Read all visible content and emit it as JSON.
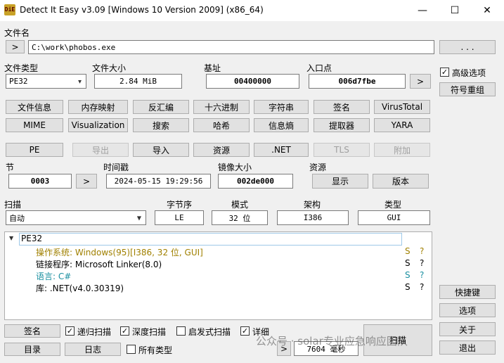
{
  "window": {
    "title": "Detect It Easy v3.09 [Windows 10 Version 2009] (x86_64)",
    "icon_label": "DiE",
    "minimize_glyph": "—",
    "maximize_glyph": "☐",
    "close_glyph": "✕"
  },
  "file": {
    "name_label": "文件名",
    "open_button": ">",
    "path": "C:\\work\\phobos.exe",
    "browse_button": ". . ."
  },
  "info": {
    "type_label": "文件类型",
    "type_value": "PE32",
    "size_label": "文件大小",
    "size_value": "2.84 MiB",
    "base_label": "基址",
    "base_value": "00400000",
    "entry_label": "入口点",
    "entry_value": "006d7fbe",
    "entry_button": ">"
  },
  "tools_row1": [
    "文件信息",
    "内存映射",
    "反汇编",
    "十六进制",
    "字符串",
    "签名",
    "VirusTotal"
  ],
  "tools_row2": [
    "MIME",
    "Visualization",
    "搜索",
    "哈希",
    "信息熵",
    "提取器",
    "YARA"
  ],
  "pe_row": {
    "pe": "PE",
    "export": "导出",
    "import": "导入",
    "resource": "资源",
    "net": ".NET",
    "tls": "TLS",
    "overlay": "附加"
  },
  "section": {
    "sections_label": "节",
    "sections_value": "0003",
    "sections_button": ">",
    "timestamp_label": "时间戳",
    "timestamp_value": "2024-05-15 19:29:56",
    "image_size_label": "镜像大小",
    "image_size_value": "002de000",
    "resources_label": "资源",
    "show_button": "显示",
    "version_button": "版本"
  },
  "scan_opts": {
    "scan_label": "扫描",
    "scan_value": "自动",
    "endian_label": "字节序",
    "endian_value": "LE",
    "mode_label": "模式",
    "mode_value": "32 位",
    "arch_label": "架构",
    "arch_value": "I386",
    "type_label": "类型",
    "type_value": "GUI"
  },
  "results": {
    "root": "PE32",
    "expand_glyph": "▼",
    "items": [
      {
        "text": "操作系统: Windows(95)[I386, 32 位, GUI]",
        "color": "#a08000",
        "s": "S",
        "q": "?"
      },
      {
        "text": "链接程序: Microsoft Linker(8.0)",
        "color": "#000000",
        "s": "S",
        "q": "?"
      },
      {
        "text": "语言: C#",
        "color": "#1a8fa0",
        "s": "S",
        "q": "?"
      },
      {
        "text": "库: .NET(v4.0.30319)",
        "color": "#000000",
        "s": "S",
        "q": "?"
      }
    ]
  },
  "right_panel": {
    "advanced_label": "高级选项",
    "advanced_checked": "✓",
    "regroup_button": "符号重组",
    "shortcut_button": "快捷键",
    "options_button": "选项",
    "about_button": "关于",
    "exit_button": "退出"
  },
  "bottom": {
    "signature_button": "签名",
    "recursive_label": "递归扫描",
    "recursive_checked": "✓",
    "deep_label": "深度扫描",
    "deep_checked": "✓",
    "heuristic_label": "启发式扫描",
    "heuristic_checked": "",
    "verbose_label": "详细",
    "verbose_checked": "✓",
    "directory_button": "目录",
    "log_button": "日志",
    "all_types_label": "所有类型",
    "all_types_checked": "",
    "time_button": ">",
    "time_value": "7604 毫秒",
    "scan_button": "扫描"
  },
  "watermark": "公众号 · solar专业应急响应团队"
}
